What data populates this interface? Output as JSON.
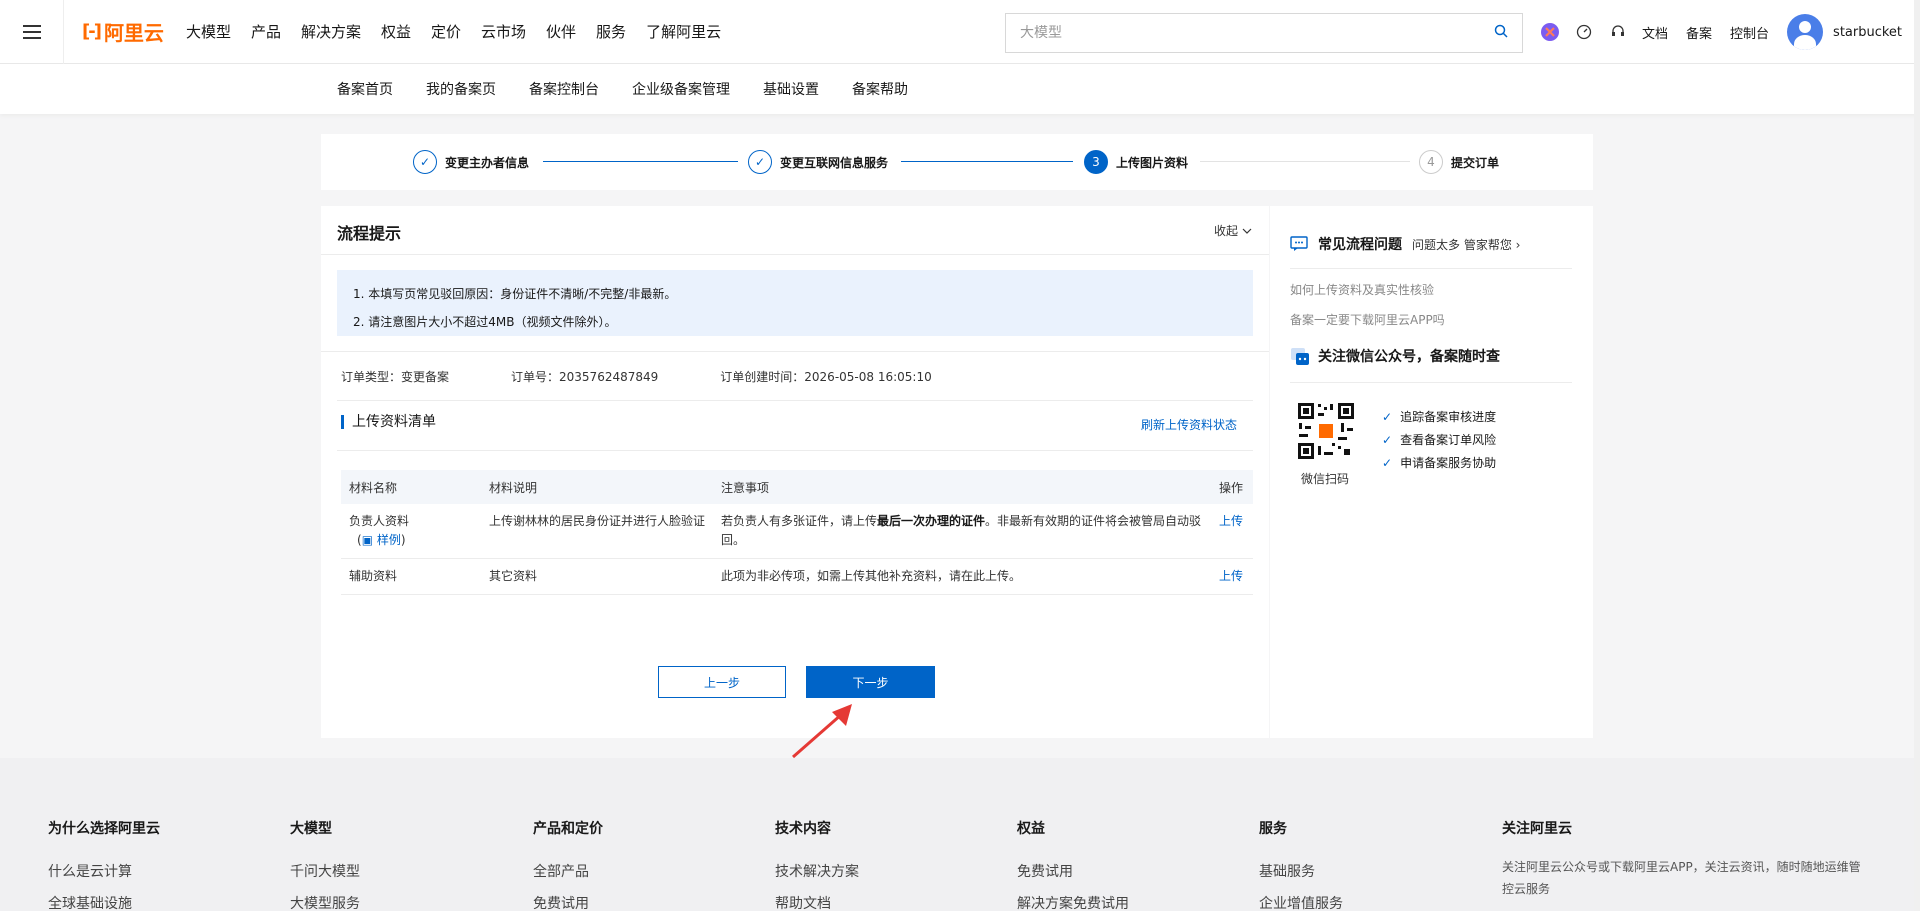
{
  "header": {
    "logo_text": "阿里云",
    "nav": [
      "大模型",
      "产品",
      "解决方案",
      "权益",
      "定价",
      "云市场",
      "伙伴",
      "服务",
      "了解阿里云"
    ],
    "search_placeholder": "大模型",
    "right_links": [
      "文档",
      "备案",
      "控制台"
    ],
    "username": "starbucket"
  },
  "subnav": [
    "备案首页",
    "我的备案页",
    "备案控制台",
    "企业级备案管理",
    "基础设置",
    "备案帮助"
  ],
  "steps": [
    {
      "label": "变更主办者信息",
      "state": "done"
    },
    {
      "label": "变更互联网信息服务",
      "state": "done"
    },
    {
      "num": "3",
      "label": "上传图片资料",
      "state": "active"
    },
    {
      "num": "4",
      "label": "提交订单",
      "state": "todo"
    }
  ],
  "panel": {
    "title": "流程提示",
    "collapse": "收起",
    "tips": [
      "1. 本填写页常见驳回原因：身份证件不清晰/不完整/非最新。",
      "2. 请注意图片大小不超过4MB（视频文件除外）。"
    ],
    "order_type": "订单类型：变更备案",
    "order_no": "订单号：2035762487849",
    "order_time": "订单创建时间：2026-05-08 16:05:10",
    "list_title": "上传资料清单",
    "refresh": "刷新上传资料状态",
    "table": {
      "headers": [
        "材料名称",
        "材料说明",
        "注意事项",
        "操作"
      ],
      "rows": [
        {
          "name": "负责人资料",
          "sample": "样例",
          "desc": "上传谢林林的居民身份证并进行人脸验证",
          "note_pre": "若负责人有多张证件，请上传",
          "note_bold": "最后一次办理的证件",
          "note_post": "。非最新有效期的证件将会被管局自动驳回。",
          "action": "上传"
        },
        {
          "name": "辅助资料",
          "desc": "其它资料",
          "note_pre": "此项为非必传项，如需上传其他补充资料，请在此上传。",
          "note_bold": "",
          "note_post": "",
          "action": "上传"
        }
      ]
    },
    "prev": "上一步",
    "next": "下一步"
  },
  "sidebar": {
    "faq_title": "常见流程问题",
    "faq_more": "问题太多 管家帮您",
    "faq": [
      "如何上传资料及真实性核验",
      "备案一定要下载阿里云APP吗"
    ],
    "wechat_title": "关注微信公众号，备案随时查",
    "qr_label": "微信扫码",
    "checks": [
      "追踪备案审核进度",
      "查看备案订单风险",
      "申请备案服务协助"
    ]
  },
  "footer": {
    "cols": [
      {
        "title": "为什么选择阿里云",
        "items": [
          "什么是云计算",
          "全球基础设施"
        ]
      },
      {
        "title": "大模型",
        "items": [
          "千问大模型",
          "大模型服务"
        ]
      },
      {
        "title": "产品和定价",
        "items": [
          "全部产品",
          "免费试用"
        ]
      },
      {
        "title": "技术内容",
        "items": [
          "技术解决方案",
          "帮助文档"
        ]
      },
      {
        "title": "权益",
        "items": [
          "免费试用",
          "解决方案免费试用"
        ]
      },
      {
        "title": "服务",
        "items": [
          "基础服务",
          "企业增值服务"
        ]
      }
    ],
    "follow_title": "关注阿里云",
    "follow_text": "关注阿里云公众号或下载阿里云APP，关注云资讯，随时随地运维管控云服务"
  },
  "colors": {
    "brand": "#ff6a00",
    "primary": "#0064c8",
    "tip_bg": "#eaf2fd"
  }
}
